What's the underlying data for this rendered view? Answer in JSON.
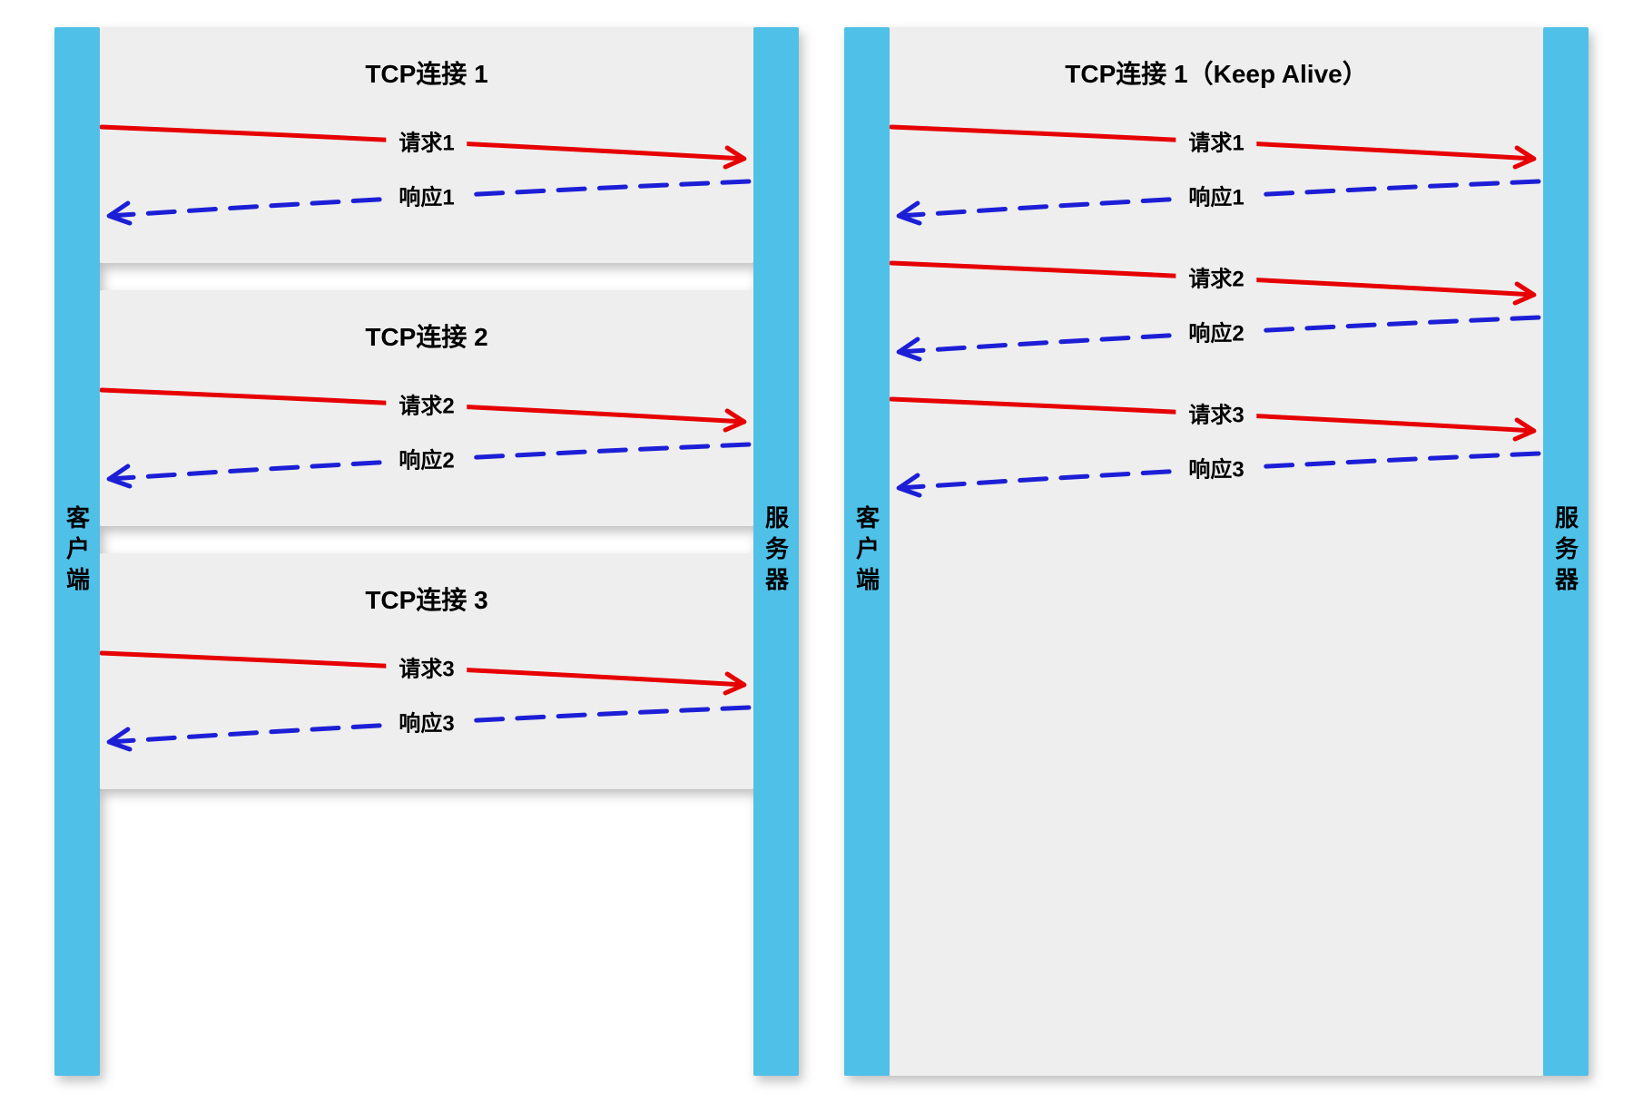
{
  "labels": {
    "client": "客户端",
    "server": "服务器"
  },
  "left_panel": {
    "connections": [
      {
        "title": "TCP连接 1",
        "request": "请求1",
        "response": "响应1"
      },
      {
        "title": "TCP连接 2",
        "request": "请求2",
        "response": "响应2"
      },
      {
        "title": "TCP连接 3",
        "request": "请求3",
        "response": "响应3"
      }
    ]
  },
  "right_panel": {
    "title": "TCP连接 1（Keep Alive）",
    "exchanges": [
      {
        "request": "请求1",
        "response": "响应1"
      },
      {
        "request": "请求2",
        "response": "响应2"
      },
      {
        "request": "请求3",
        "response": "响应3"
      }
    ]
  },
  "colors": {
    "request": "#e60000",
    "response": "#1c1fd6",
    "bar": "#4fc0e8",
    "box": "#eeeeee"
  }
}
